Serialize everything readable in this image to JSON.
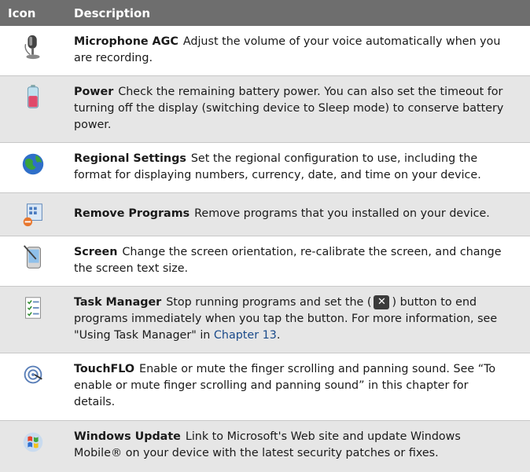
{
  "header": {
    "icon_col": "Icon",
    "desc_col": "Description"
  },
  "rows": [
    {
      "title": "Microphone AGC",
      "text": "Adjust the volume of your voice automatically when you are recording.",
      "icon": "microphone-icon"
    },
    {
      "title": "Power",
      "text": "Check the remaining battery power. You can also set the timeout for turning off the display (switching device to Sleep mode) to conserve battery power.",
      "icon": "battery-icon"
    },
    {
      "title": "Regional Settings",
      "text": "Set the regional configuration to use, including the format for displaying numbers, currency, date, and time on your device.",
      "icon": "globe-icon"
    },
    {
      "title": "Remove Programs",
      "text": "Remove programs that you installed on your device.",
      "icon": "remove-programs-icon"
    },
    {
      "title": "Screen",
      "text": "Change the screen orientation, re-calibrate the screen, and change the screen text size.",
      "icon": "screen-stylus-icon"
    },
    {
      "title": "Task Manager",
      "text_before": "Stop running programs and set the (",
      "button_glyph": "✕",
      "text_after": ") button to end programs immediately when you tap the button. For more information, see \"Using Task Manager\" in",
      "chapter_ref": "Chapter 13",
      "text_end": ".",
      "icon": "task-manager-icon"
    },
    {
      "title": "TouchFLO",
      "text": "Enable or mute the finger scrolling and panning sound. See “To enable or mute finger scrolling and panning sound” in this chapter for details.",
      "icon": "touchflo-icon"
    },
    {
      "title": "Windows Update",
      "text": "Link to Microsoft's Web site and update Windows Mobile® on your device with the latest security patches or fixes.",
      "icon": "windows-update-icon"
    }
  ]
}
